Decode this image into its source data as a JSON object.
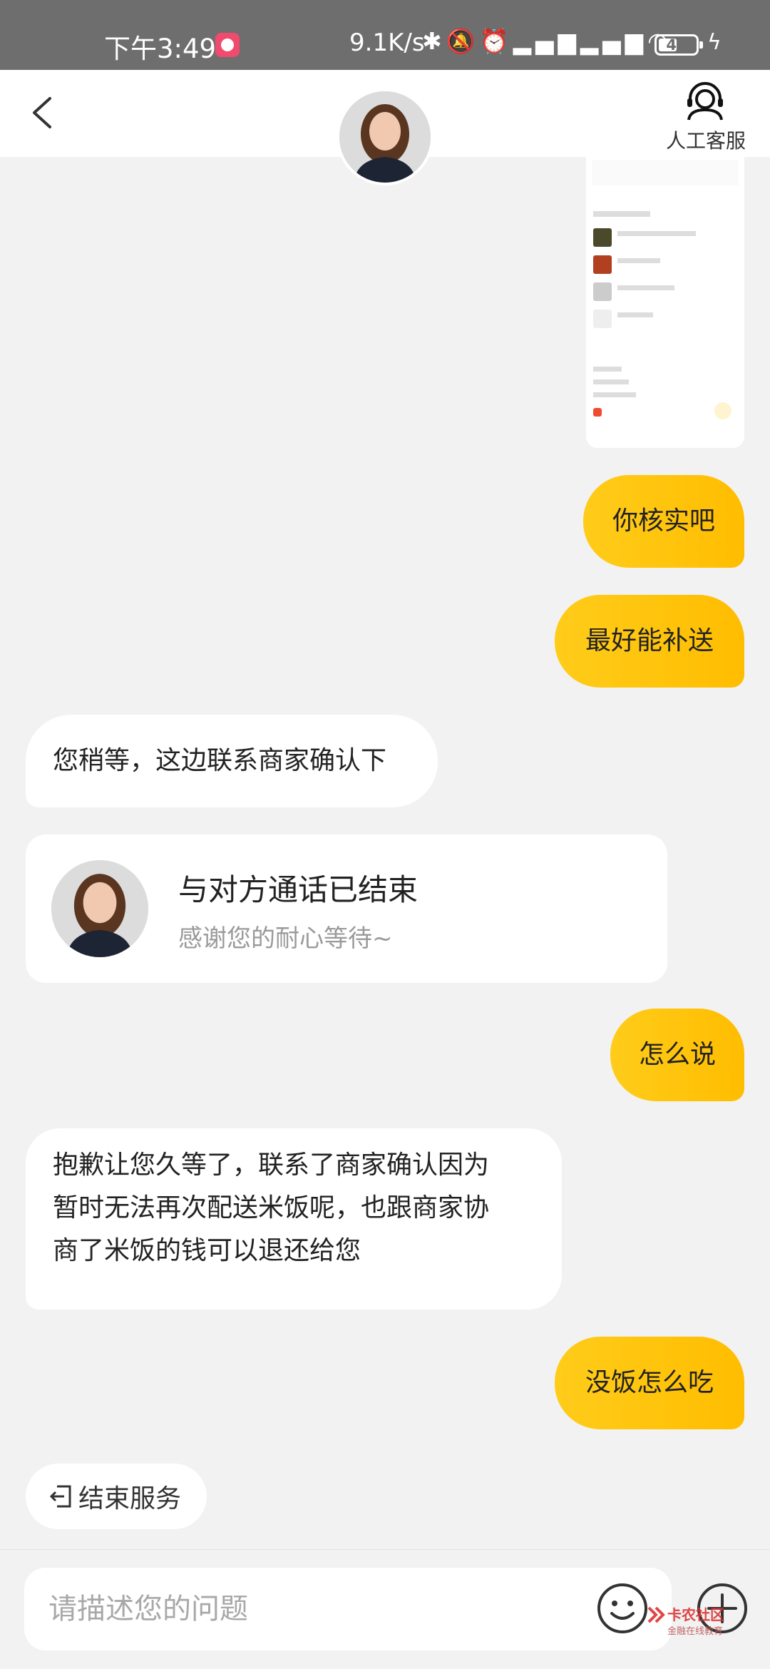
{
  "status_bar": {
    "time": "下午3:49",
    "speed": "9.1K/s",
    "icons": [
      "bluetooth-icon",
      "mute-icon",
      "alarm-icon",
      "signal-icon",
      "hd-signal-icon",
      "wifi-icon"
    ],
    "battery": "49",
    "battery_level": 0.49
  },
  "header": {
    "back_icon": "chevron-left-icon",
    "agent_avatar": "agent-avatar",
    "service_icon": "headset-icon",
    "service_label": "人工客服"
  },
  "chat": {
    "messages": [
      {
        "dir": "out",
        "text": "你核实吧"
      },
      {
        "dir": "out",
        "text": "最好能补送"
      },
      {
        "dir": "in",
        "text": "您稍等，这边联系商家确认下"
      },
      {
        "dir": "out",
        "text": "怎么说"
      },
      {
        "dir": "in",
        "lines": [
          "抱歉让您久等了，联系了商家确认因为",
          "暂时无法再次配送米饭呢，也跟商家协",
          "商了米饭的钱可以退还给您"
        ]
      },
      {
        "dir": "out",
        "text": "没饭怎么吃"
      }
    ],
    "call_card": {
      "title": "与对方通话已结束",
      "subtitle": "感谢您的耐心等待~"
    }
  },
  "end_service": {
    "label": "结束服务",
    "icon": "exit-icon"
  },
  "input": {
    "placeholder": "请描述您的问题",
    "value": "",
    "emoji_icon": "emoji-icon",
    "plus_icon": "plus-icon"
  },
  "watermark": {
    "title": "卡农社区",
    "subtitle": "金融在线教育"
  },
  "colors": {
    "accent": "#ffc300",
    "status_bar": "#6e6e6e",
    "background": "#f2f2f2"
  }
}
